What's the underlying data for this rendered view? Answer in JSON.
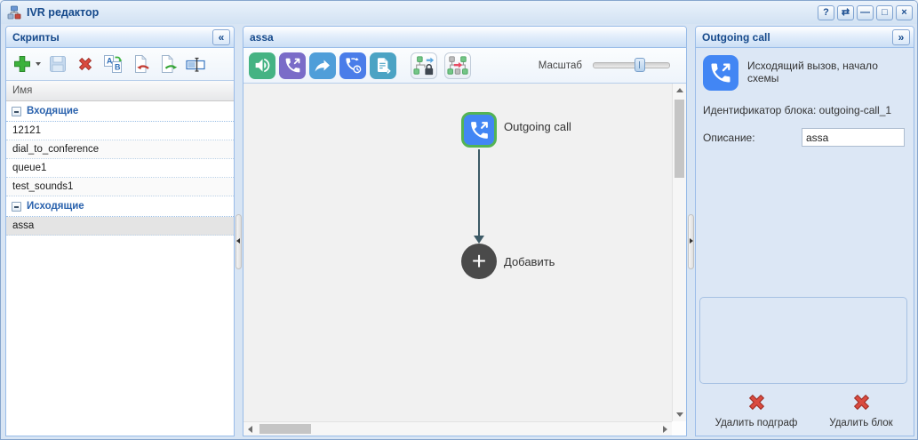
{
  "window": {
    "title": "IVR редактор",
    "controls": {
      "help": "?",
      "refresh": "⇄",
      "minimize": "—",
      "maximize": "□",
      "close": "×"
    }
  },
  "left_panel": {
    "title": "Скрипты",
    "collapse_glyph": "«",
    "grid_header": "Имя",
    "toolbar_icons": [
      "add",
      "add-menu",
      "save",
      "delete",
      "rename",
      "import",
      "export",
      "edit-name"
    ],
    "groups": [
      {
        "label": "Входящие",
        "items": [
          "12121",
          "dial_to_conference",
          "queue1",
          "test_sounds1"
        ]
      },
      {
        "label": "Исходящие",
        "items": [
          "assa"
        ]
      }
    ],
    "selected_item": "assa"
  },
  "canvas_panel": {
    "title": "assa",
    "toolbar_icons": [
      "play-sound",
      "outgoing-call",
      "transfer",
      "redial-timer",
      "script",
      "subgraph-lock",
      "subgraph-insert"
    ],
    "scale_label": "Масштаб",
    "node": {
      "label": "Outgoing call"
    },
    "add_button": {
      "label": "Добавить",
      "glyph": "+"
    }
  },
  "right_panel": {
    "title": "Outgoing call",
    "expand_glyph": "»",
    "subtitle": "Исходящий вызов, начало схемы",
    "block_id_text": "Идентификатор блока: outgoing-call_1",
    "description_label": "Описание:",
    "description_value": "assa",
    "buttons": [
      {
        "label": "Удалить подграф"
      },
      {
        "label": "Удалить блок"
      }
    ]
  },
  "colors": {
    "accent_text": "#15498b",
    "panel_border": "#99bce8",
    "node_blue": "#4286f4",
    "node_selected_border": "#54b454",
    "add_circle": "#4a4a4a",
    "delete_red": "#da4b40"
  }
}
